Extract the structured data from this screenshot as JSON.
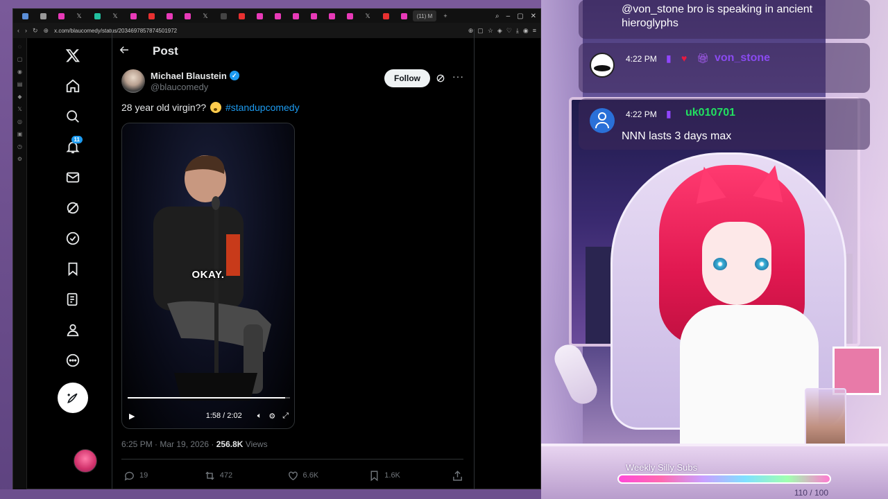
{
  "browser": {
    "url": "x.com/blaucomedy/status/2034697857874501972",
    "active_tab_label": "(11) M"
  },
  "nav": {
    "notifications_badge": "11"
  },
  "post": {
    "header_title": "Post",
    "author_name": "Michael Blaustein",
    "author_handle": "@blaucomedy",
    "follow_label": "Follow",
    "text": "28 year old virgin??",
    "hashtag": "#standupcomedy",
    "video_caption": "OKAY.",
    "video_time": "1:58 / 2:02",
    "video_progress_percent": 97,
    "timestamp": "6:25 PM · Mar 19, 2026 ·",
    "views_count": "256.8K",
    "views_label": "Views",
    "replies": "19",
    "reposts": "472",
    "likes": "6.6K",
    "bookmarks": "1.6K"
  },
  "chat": {
    "msg1_text": "@von_stone bro is speaking in ancient hieroglyphs",
    "msg2_time": "4:22 PM",
    "msg2_user": "von_stone",
    "msg2_user_color": "#8a4af0",
    "msg3_time": "4:22 PM",
    "msg3_user": "uk010701",
    "msg3_user_color": "#22e060",
    "msg3_text": "NNN lasts 3 days max"
  },
  "overlay": {
    "subs_goal_label": "Weekly Silly Subs",
    "subs_goal_count": "110 / 100"
  },
  "colors": {
    "x_blue": "#1d9bf0",
    "background": "#000000",
    "accent_pink": "#ff3a70"
  }
}
